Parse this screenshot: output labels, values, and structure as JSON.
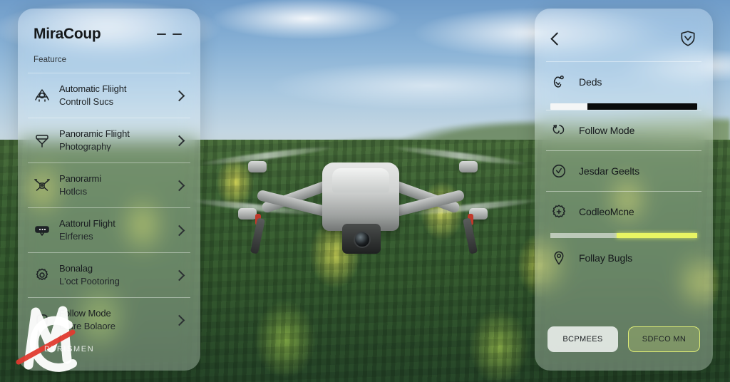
{
  "background": {
    "scene": "aerial-drone-over-forest",
    "subject": "quadcopter-drone",
    "colors": {
      "sky": "#89b2d6",
      "forest": "#3f6637",
      "foliage_accent": "#c9cf52",
      "drone_body": "#d2d4d3"
    }
  },
  "left_panel": {
    "title": "MiraCoup",
    "menu_icon": "two-dashes-icon",
    "section_label": "Featurce",
    "items": [
      {
        "icon": "drone-outline-icon",
        "line1": "Automatic Fliight",
        "line2": "Controll Sucs",
        "chevron": "chevron-right-icon"
      },
      {
        "icon": "camera-funnel-icon",
        "line1": "Panoramic Fliight",
        "line2": "Photographγ",
        "chevron": "chevron-right-icon"
      },
      {
        "icon": "quadcopter-icon",
        "line1": "Panorarmi",
        "line2": "Hotlcıs",
        "chevron": "chevron-right-icon"
      },
      {
        "icon": "battery-status-icon",
        "line1": "Aattorul Flight",
        "line2": "Elrferıes",
        "chevron": "chevron-right-icon"
      },
      {
        "icon": "gear-icon",
        "line1": "Bonalag",
        "line2": "L'oct Pootoring",
        "chevron": "chevron-right-icon"
      },
      {
        "icon": "square-rounded-icon",
        "line1": "Follow Mode",
        "line2": "Catre Bolaore",
        "chevron": "chevron-right-icon"
      }
    ]
  },
  "right_panel": {
    "back_icon": "chevron-left-icon",
    "badge_icon": "shield-check-icon",
    "rows": [
      {
        "icon": "drone-alert-icon",
        "label": "Deds"
      },
      {
        "icon": "follow-path-icon",
        "label": "Follow Mode"
      },
      {
        "icon": "clock-check-icon",
        "label": "Jesdar Geelts"
      },
      {
        "icon": "gear-plus-icon",
        "label": "CodleoMcne"
      },
      {
        "icon": "location-pin-icon",
        "label": "Follay Bugls"
      }
    ],
    "progress_bar": {
      "fill_percent": 25,
      "track_color": "#0a0b0b",
      "fill_color": "#f4f6f6"
    },
    "highlight_bar": {
      "start_percent": 45,
      "color": "#e9f563"
    },
    "buttons": [
      {
        "label": "BCPMEES",
        "style": "primary"
      },
      {
        "label": "SDFCO MN",
        "style": "ghost"
      }
    ]
  },
  "watermark": {
    "letters": "MC",
    "text": "DTRISMEN",
    "stroke_color": "#e03a2f",
    "letter_color": "#ffffff"
  }
}
